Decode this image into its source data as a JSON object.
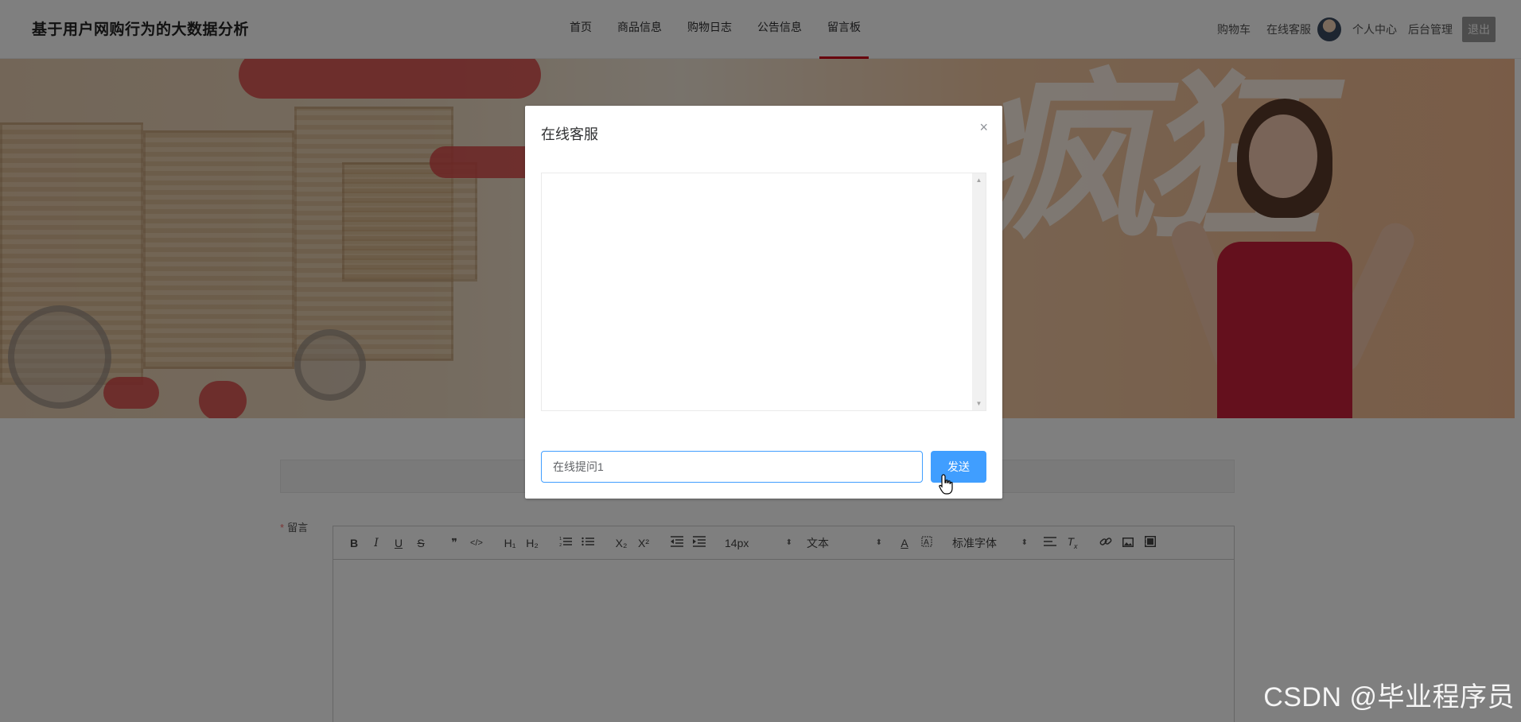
{
  "header": {
    "site_title": "基于用户网购行为的大数据分析",
    "nav": [
      {
        "label": "首页"
      },
      {
        "label": "商品信息"
      },
      {
        "label": "购物日志"
      },
      {
        "label": "公告信息"
      },
      {
        "label": "留言板",
        "active": true
      }
    ],
    "right": {
      "cart": "购物车",
      "service": "在线客服",
      "profile": "个人中心",
      "admin": "后台管理",
      "logout": "退出"
    }
  },
  "form": {
    "required_mark": "*",
    "message_label": "留言"
  },
  "editor": {
    "font_size": "14px",
    "header_style": "文本",
    "font_family": "标准字体",
    "buttons": [
      "B",
      "I",
      "U",
      "S",
      "❞",
      "</>",
      "H₁",
      "H₂",
      "ordered-list",
      "bullet-list",
      "X₂",
      "X²",
      "outdent",
      "indent",
      "A",
      "highlight",
      "align",
      "clear-format",
      "link",
      "image",
      "video"
    ]
  },
  "dialog": {
    "title": "在线客服",
    "close": "×",
    "input_value": "在线提问1",
    "send_label": "发送"
  },
  "watermark": "CSDN @毕业程序员",
  "colors": {
    "primary": "#409eff",
    "nav_active": "#d0021b",
    "mask": "rgba(0,0,0,0.5)"
  }
}
